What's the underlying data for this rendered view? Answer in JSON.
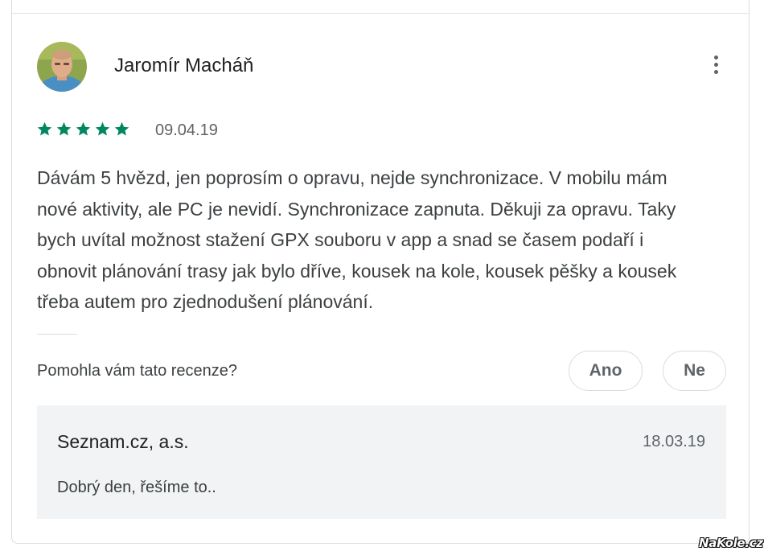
{
  "review": {
    "author": "Jaromír Macháň",
    "rating": 5,
    "date": "09.04.19",
    "text": "Dávám 5 hvězd, jen poprosím o opravu, nejde synchronizace. V mobilu mám nové aktivity, ale PC je nevidí. Synchronizace zapnuta. Děkuji za opravu. Taky bych uvítal možnost stažení GPX souboru v app a snad se časem podaří i obnovit plánování trasy jak bylo dříve, kousek na kole, kousek pěšky a kousek třeba autem pro zjednodušení plánování.",
    "star_color": "#01875f",
    "menu_icon": "more-vert-icon"
  },
  "helpful": {
    "question": "Pomohla vám tato recenze?",
    "yes_label": "Ano",
    "no_label": "Ne"
  },
  "developer_reply": {
    "developer": "Seznam.cz, a.s.",
    "date": "18.03.19",
    "text": "Dobrý den, řešíme to.."
  },
  "watermark": "NaKole.cz"
}
